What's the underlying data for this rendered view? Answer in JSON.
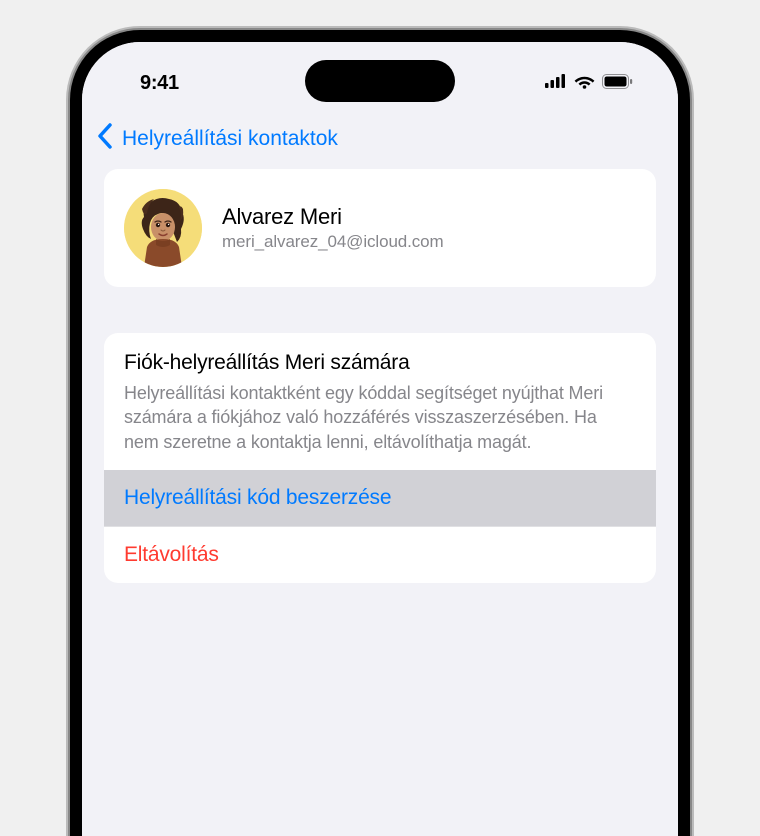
{
  "status": {
    "time": "9:41"
  },
  "nav": {
    "back_label": "Helyreállítási kontaktok"
  },
  "contact": {
    "name": "Alvarez Meri",
    "email": "meri_alvarez_04@icloud.com"
  },
  "recovery": {
    "title": "Fiók-helyreállítás Meri számára",
    "description": "Helyreállítási kontaktként egy kóddal segítséget nyújthat Meri számára a fiókjához való hozzáférés visszaszerzésében. Ha nem szeretne a kontaktja lenni, eltávolíthatja magát.",
    "get_code_label": "Helyreállítási kód beszerzése",
    "remove_label": "Eltávolítás"
  }
}
